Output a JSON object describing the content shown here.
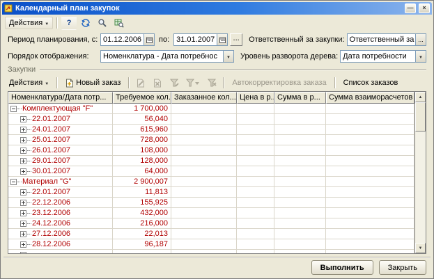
{
  "window": {
    "title": "Календарный план закупок",
    "controls": {
      "minimize": "—",
      "close": "×"
    }
  },
  "toolbar_main": {
    "actions_label": "Действия",
    "help_label": "?"
  },
  "filters": {
    "period_label": "Период планирования, с:",
    "period_from": "01.12.2006",
    "to_label": "по:",
    "period_to": "31.01.2007",
    "more_label": "...",
    "responsible_label": "Ответственный за закупки:",
    "responsible_value": "Ответственный за закупки = \"Н...",
    "display_order_label": "Порядок отображения:",
    "display_order_value": "Номенклатура - Дата потребнос",
    "tree_level_label": "Уровень разворота дерева:",
    "tree_level_value": "Дата потребности"
  },
  "purchases": {
    "group_label": "Закупки",
    "actions_label": "Действия",
    "new_order_label": "Новый заказ",
    "autocorrect_label": "Автокорректировка заказа",
    "orders_list_label": "Список заказов"
  },
  "table": {
    "columns": [
      "Номенклатура/Дата потр...",
      "Требуемое кол...",
      "Заказанное кол...",
      "Цена в р...",
      "Сумма в р...",
      "Сумма взаиморасчетов"
    ],
    "rows": [
      {
        "level": 0,
        "expand": "minus",
        "name": "Комплектующая \"F\"",
        "required_qty": "1 700,000"
      },
      {
        "level": 1,
        "expand": "plus",
        "name": "22.01.2007",
        "required_qty": "56,040"
      },
      {
        "level": 1,
        "expand": "plus",
        "name": "24.01.2007",
        "required_qty": "615,960"
      },
      {
        "level": 1,
        "expand": "plus",
        "name": "25.01.2007",
        "required_qty": "728,000"
      },
      {
        "level": 1,
        "expand": "plus",
        "name": "26.01.2007",
        "required_qty": "108,000"
      },
      {
        "level": 1,
        "expand": "plus",
        "name": "29.01.2007",
        "required_qty": "128,000"
      },
      {
        "level": 1,
        "expand": "plus",
        "name": "30.01.2007",
        "required_qty": "64,000"
      },
      {
        "level": 0,
        "expand": "minus",
        "name": "Материал \"G\"",
        "required_qty": "2 900,007"
      },
      {
        "level": 1,
        "expand": "plus",
        "name": "22.01.2007",
        "required_qty": "11,813"
      },
      {
        "level": 1,
        "expand": "plus",
        "name": "22.12.2006",
        "required_qty": "155,925"
      },
      {
        "level": 1,
        "expand": "plus",
        "name": "23.12.2006",
        "required_qty": "432,000"
      },
      {
        "level": 1,
        "expand": "plus",
        "name": "24.12.2006",
        "required_qty": "216,000"
      },
      {
        "level": 1,
        "expand": "plus",
        "name": "27.12.2006",
        "required_qty": "22,013"
      },
      {
        "level": 1,
        "expand": "plus",
        "name": "28.12.2006",
        "required_qty": "96,187"
      }
    ]
  },
  "footer": {
    "run_label": "Выполнить",
    "close_label": "Закрыть"
  }
}
